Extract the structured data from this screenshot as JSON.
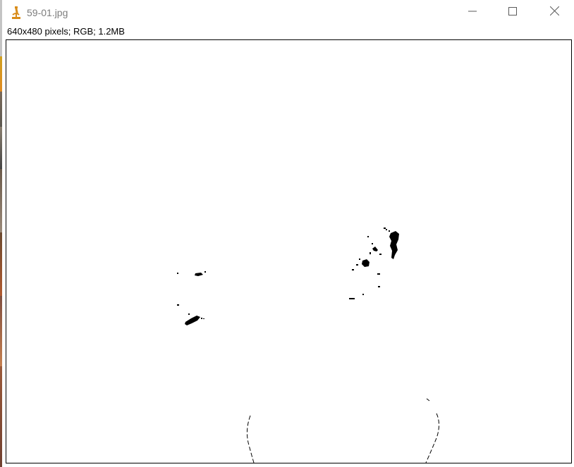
{
  "window": {
    "title": "59-01.jpg",
    "app_icon": "microscope-icon",
    "controls": {
      "minimize_icon": "minimize-icon",
      "maximize_icon": "maximize-icon",
      "close_icon": "close-icon"
    }
  },
  "image_info": "640x480 pixels; RGB; 1.2MB",
  "colors": {
    "title_text": "#7d7d7d",
    "icon_accent": "#d98c1a",
    "canvas_bg": "#ffffff",
    "ink": "#000000"
  }
}
